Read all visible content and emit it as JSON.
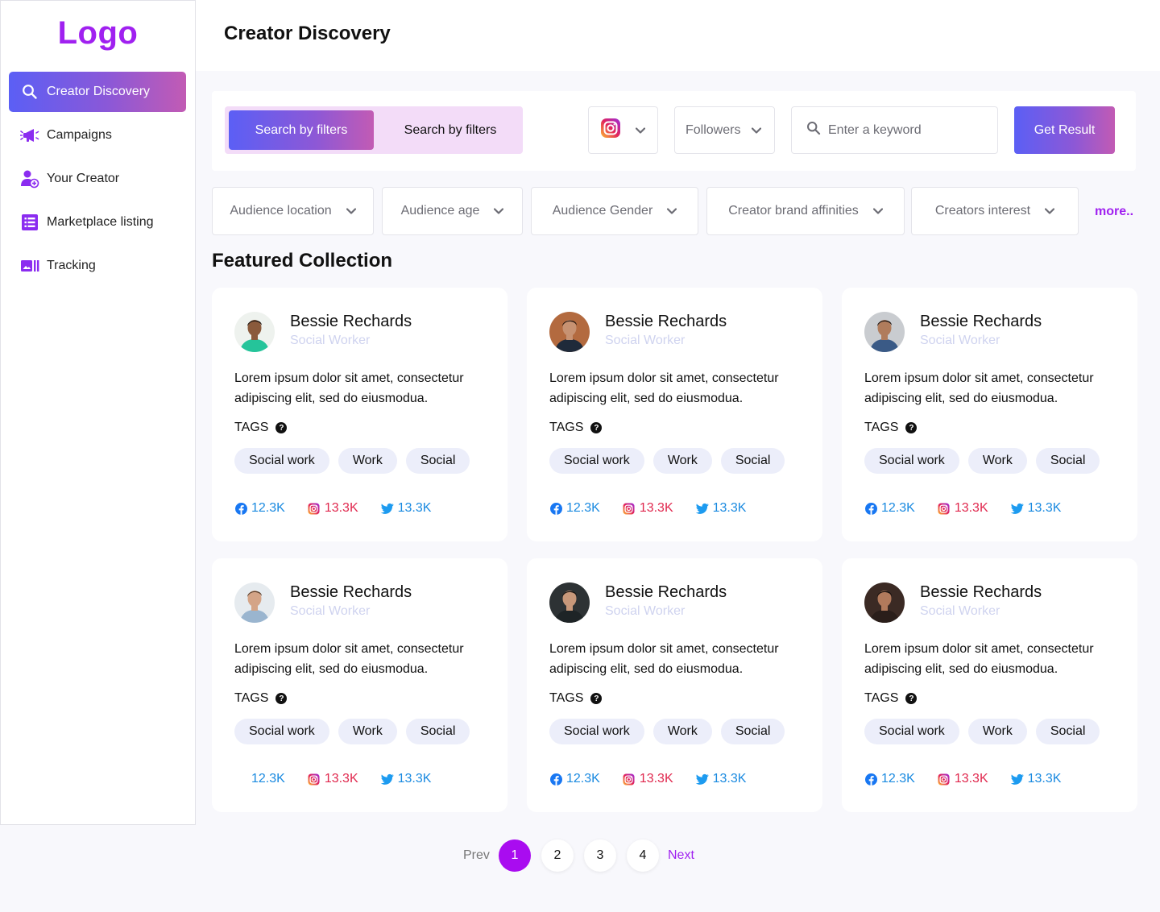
{
  "brand": {
    "logo_text": "Logo",
    "accent": "#a021f0"
  },
  "sidebar": {
    "items": [
      {
        "label": "Creator Discovery",
        "icon": "search-icon",
        "active": true
      },
      {
        "label": "Campaigns",
        "icon": "megaphone-icon"
      },
      {
        "label": "Your Creator",
        "icon": "user-add-icon"
      },
      {
        "label": "Marketplace listing",
        "icon": "list-icon"
      },
      {
        "label": "Tracking",
        "icon": "chart-icon"
      }
    ]
  },
  "header": {
    "title": "Creator Discovery"
  },
  "search": {
    "toggle": [
      "Search by filters",
      "Search by filters"
    ],
    "platform_icon": "instagram-icon",
    "followers_label": "Followers",
    "keyword_placeholder": "Enter a keyword",
    "submit_label": "Get Result"
  },
  "filters": [
    "Audience location",
    "Audience age",
    "Audience Gender",
    "Creator brand affinities",
    "Creators interest"
  ],
  "more_label": "more..",
  "featured": {
    "title": "Featured Collection",
    "tags_label": "TAGS",
    "cards": [
      {
        "name": "Bessie Rechards",
        "role": "Social Worker",
        "description": "Lorem ipsum dolor sit amet, consectetur adipiscing elit, sed do eiusmodua.",
        "tags": [
          "Social work",
          "Work",
          "Social"
        ],
        "stats": {
          "facebook": "12.3K",
          "instagram": "13.3K",
          "twitter": "13.3K"
        },
        "show_facebook_icon": true
      },
      {
        "name": "Bessie Rechards",
        "role": "Social Worker",
        "description": "Lorem ipsum dolor sit amet, consectetur adipiscing elit, sed do eiusmodua.",
        "tags": [
          "Social work",
          "Work",
          "Social"
        ],
        "stats": {
          "facebook": "12.3K",
          "instagram": "13.3K",
          "twitter": "13.3K"
        },
        "show_facebook_icon": true
      },
      {
        "name": "Bessie Rechards",
        "role": "Social Worker",
        "description": "Lorem ipsum dolor sit amet, consectetur adipiscing elit, sed do eiusmodua.",
        "tags": [
          "Social work",
          "Work",
          "Social"
        ],
        "stats": {
          "facebook": "12.3K",
          "instagram": "13.3K",
          "twitter": "13.3K"
        },
        "show_facebook_icon": true
      },
      {
        "name": "Bessie Rechards",
        "role": "Social Worker",
        "description": "Lorem ipsum dolor sit amet, consectetur adipiscing elit, sed do eiusmodua.",
        "tags": [
          "Social work",
          "Work",
          "Social"
        ],
        "stats": {
          "facebook": "12.3K",
          "instagram": "13.3K",
          "twitter": "13.3K"
        },
        "show_facebook_icon": false
      },
      {
        "name": "Bessie Rechards",
        "role": "Social Worker",
        "description": "Lorem ipsum dolor sit amet, consectetur adipiscing elit, sed do eiusmodua.",
        "tags": [
          "Social work",
          "Work",
          "Social"
        ],
        "stats": {
          "facebook": "12.3K",
          "instagram": "13.3K",
          "twitter": "13.3K"
        },
        "show_facebook_icon": true
      },
      {
        "name": "Bessie Rechards",
        "role": "Social Worker",
        "description": "Lorem ipsum dolor sit amet, consectetur adipiscing elit, sed do eiusmodua.",
        "tags": [
          "Social work",
          "Work",
          "Social"
        ],
        "stats": {
          "facebook": "12.3K",
          "instagram": "13.3K",
          "twitter": "13.3K"
        },
        "show_facebook_icon": true
      }
    ]
  },
  "pagination": {
    "prev_label": "Prev",
    "next_label": "Next",
    "pages": [
      "1",
      "2",
      "3",
      "4"
    ],
    "current": "1"
  }
}
